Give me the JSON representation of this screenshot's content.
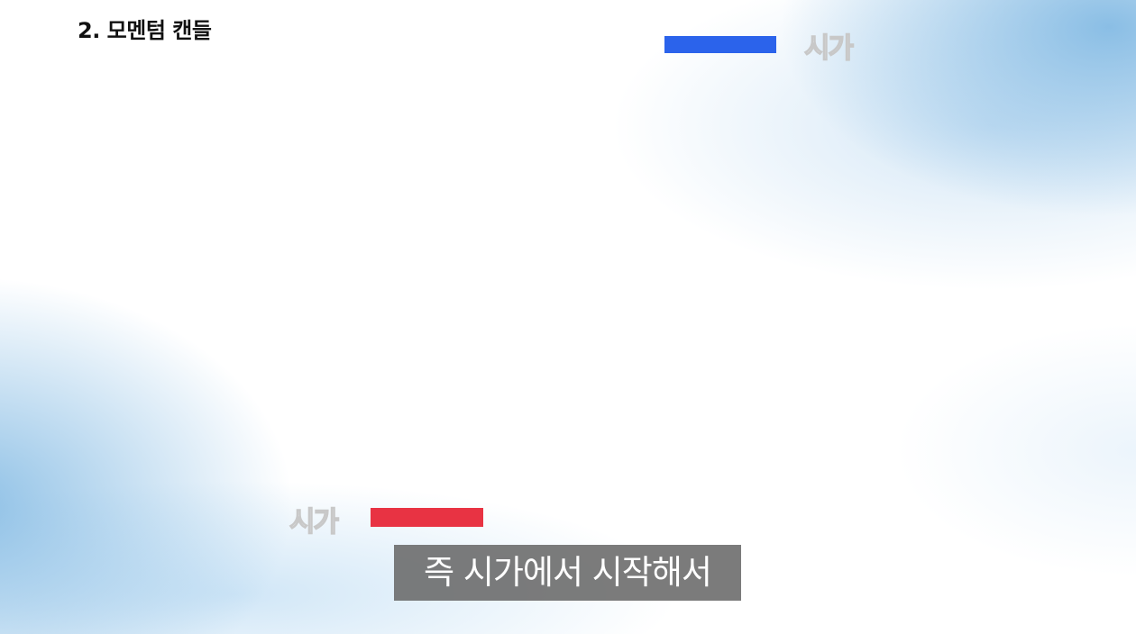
{
  "slide": {
    "title": "2. 모멘텀 캔들"
  },
  "markers": {
    "top": {
      "label": "시가",
      "color": "#2b63eb"
    },
    "bottom": {
      "label": "시가",
      "color": "#e83343"
    }
  },
  "caption": {
    "text": "즉 시가에서 시작해서"
  }
}
